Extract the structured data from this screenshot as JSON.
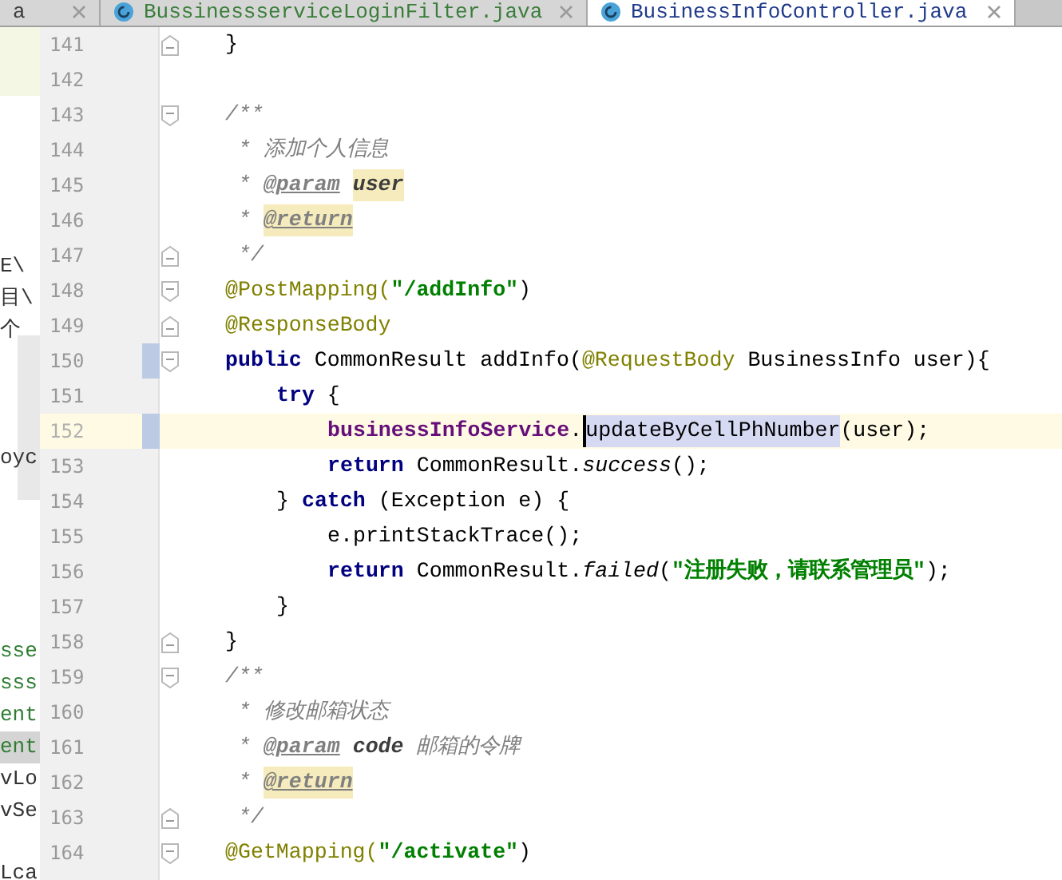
{
  "tabs": [
    {
      "label": "a",
      "selected": false,
      "color": "#3c3c3c",
      "partial": true
    },
    {
      "label": "BussinessserviceLoginFilter.java",
      "selected": false,
      "color": "#3a7d3a",
      "partial": false
    },
    {
      "label": "BusinessInfoController.java",
      "selected": true,
      "color": "#1f3a8a",
      "partial": false
    }
  ],
  "background_panel": {
    "groups": [
      [
        {
          "text": "E\\",
          "color": "#333333",
          "selected": false
        },
        {
          "text": "目\\",
          "color": "#333333",
          "selected": false
        },
        {
          "text": "个",
          "color": "#333333",
          "selected": false
        }
      ],
      [
        {
          "text": "oyc",
          "color": "#333333",
          "selected": false
        }
      ],
      [
        {
          "text": "sse",
          "color": "#2e7d32",
          "selected": false
        },
        {
          "text": "sss",
          "color": "#2e7d32",
          "selected": false
        },
        {
          "text": "ent",
          "color": "#2e7d32",
          "selected": false
        },
        {
          "text": "ent",
          "color": "#2e7d32",
          "selected": true
        },
        {
          "text": "vLo",
          "color": "#333333",
          "selected": false
        },
        {
          "text": "vSe",
          "color": "#333333",
          "selected": false
        }
      ],
      [
        {
          "text": "Lca",
          "color": "#333333",
          "selected": false
        }
      ]
    ]
  },
  "editor": {
    "lines": [
      {
        "number": "141",
        "current": false,
        "changed": false,
        "fold_start": false,
        "fold_end": true,
        "tokens": [
          {
            "kind": "plain",
            "text": "}"
          }
        ]
      },
      {
        "number": "142",
        "current": false,
        "changed": false,
        "fold_start": false,
        "fold_end": false
      },
      {
        "number": "143",
        "current": false,
        "changed": false,
        "fold_start": true,
        "fold_end": false,
        "tokens": [
          {
            "kind": "comment",
            "text": "/**"
          }
        ]
      },
      {
        "number": "144",
        "current": false,
        "changed": false,
        "fold_start": false,
        "fold_end": false,
        "tokens": [
          {
            "kind": "comment",
            "text": " * 添加个人信息"
          }
        ]
      },
      {
        "number": "145",
        "current": false,
        "changed": false,
        "fold_start": false,
        "fold_end": false,
        "tokens": [
          {
            "kind": "comment",
            "text": " * "
          },
          {
            "kind": "doctag",
            "text": "@param",
            "highlighted": false
          },
          {
            "kind": "docparam",
            "text": "user",
            "highlighted": true
          }
        ]
      },
      {
        "number": "146",
        "current": false,
        "changed": false,
        "fold_start": false,
        "fold_end": false,
        "tokens": [
          {
            "kind": "comment",
            "text": " * "
          },
          {
            "kind": "doctag",
            "text": "@return",
            "highlighted": true
          }
        ]
      },
      {
        "number": "147",
        "current": false,
        "changed": false,
        "fold_start": false,
        "fold_end": true,
        "tokens": [
          {
            "kind": "comment",
            "text": " */"
          }
        ]
      },
      {
        "number": "148",
        "current": false,
        "changed": false,
        "fold_start": true,
        "fold_end": false,
        "tokens": [
          {
            "kind": "annotation",
            "text": "@PostMapping("
          },
          {
            "kind": "string",
            "text": "\"/addInfo\""
          },
          {
            "kind": "plain",
            "text": ")"
          }
        ]
      },
      {
        "number": "149",
        "current": false,
        "changed": false,
        "fold_start": false,
        "fold_end": true,
        "tokens": [
          {
            "kind": "annotation",
            "text": "@ResponseBody"
          }
        ]
      },
      {
        "number": "150",
        "current": false,
        "changed": true,
        "fold_start": true,
        "fold_end": false,
        "tokens": [
          {
            "kind": "keyword",
            "text": "public"
          },
          {
            "kind": "plain",
            "text": " CommonResult addInfo("
          },
          {
            "kind": "annotation",
            "text": "@RequestBody"
          },
          {
            "kind": "plain",
            "text": " BusinessInfo user){"
          }
        ],
        "children": [
          {
            "number": "151",
            "current": false,
            "changed": false,
            "fold_start": false,
            "fold_end": false,
            "tokens": [
              {
                "kind": "keyword",
                "text": "try"
              },
              {
                "kind": "plain",
                "text": " {"
              }
            ],
            "children": [
              {
                "number": "152",
                "current": true,
                "changed": true,
                "fold_start": false,
                "fold_end": false,
                "tokens": [
                  {
                    "kind": "field",
                    "text": "businessInfoService"
                  },
                  {
                    "kind": "plain",
                    "text": "."
                  },
                  {
                    "kind": "selection",
                    "text": "updateByCellPhNumber",
                    "caret": true
                  },
                  {
                    "kind": "plain",
                    "text": "(user);"
                  }
                ]
              },
              {
                "number": "153",
                "current": false,
                "changed": false,
                "fold_start": false,
                "fold_end": false,
                "tokens": [
                  {
                    "kind": "keyword",
                    "text": "return"
                  },
                  {
                    "kind": "plain",
                    "text": " CommonResult."
                  },
                  {
                    "kind": "static",
                    "text": "success"
                  },
                  {
                    "kind": "plain",
                    "text": "();"
                  }
                ]
              }
            ]
          },
          {
            "number": "154",
            "current": false,
            "changed": false,
            "fold_start": false,
            "fold_end": false,
            "tokens": [
              {
                "kind": "plain",
                "text": "} "
              },
              {
                "kind": "keyword",
                "text": "catch"
              },
              {
                "kind": "plain",
                "text": " (Exception e) {"
              }
            ],
            "children": [
              {
                "number": "155",
                "current": false,
                "changed": false,
                "fold_start": false,
                "fold_end": false,
                "tokens": [
                  {
                    "kind": "plain",
                    "text": "e.printStackTrace();"
                  }
                ]
              },
              {
                "number": "156",
                "current": false,
                "changed": false,
                "fold_start": false,
                "fold_end": false,
                "tokens": [
                  {
                    "kind": "keyword",
                    "text": "return"
                  },
                  {
                    "kind": "plain",
                    "text": " CommonResult."
                  },
                  {
                    "kind": "static",
                    "text": "failed"
                  },
                  {
                    "kind": "plain",
                    "text": "("
                  },
                  {
                    "kind": "string",
                    "text": "\"注册失败，请联系管理员\""
                  },
                  {
                    "kind": "plain",
                    "text": ");"
                  }
                ]
              }
            ]
          },
          {
            "number": "157",
            "current": false,
            "changed": false,
            "fold_start": false,
            "fold_end": false,
            "tokens": [
              {
                "kind": "plain",
                "text": "}"
              }
            ]
          }
        ]
      },
      {
        "number": "158",
        "current": false,
        "changed": false,
        "fold_start": false,
        "fold_end": true,
        "tokens": [
          {
            "kind": "plain",
            "text": "}"
          }
        ]
      },
      {
        "number": "159",
        "current": false,
        "changed": false,
        "fold_start": true,
        "fold_end": false,
        "tokens": [
          {
            "kind": "comment",
            "text": "/**"
          }
        ]
      },
      {
        "number": "160",
        "current": false,
        "changed": false,
        "fold_start": false,
        "fold_end": false,
        "tokens": [
          {
            "kind": "comment",
            "text": " * 修改邮箱状态"
          }
        ]
      },
      {
        "number": "161",
        "current": false,
        "changed": false,
        "fold_start": false,
        "fold_end": false,
        "tokens": [
          {
            "kind": "comment",
            "text": " * "
          },
          {
            "kind": "doctag",
            "text": "@param",
            "highlighted": false
          },
          {
            "kind": "docparam",
            "text": "code",
            "highlighted": false
          },
          {
            "kind": "comment",
            "text": " 邮箱的令牌"
          }
        ]
      },
      {
        "number": "162",
        "current": false,
        "changed": false,
        "fold_start": false,
        "fold_end": false,
        "tokens": [
          {
            "kind": "comment",
            "text": " * "
          },
          {
            "kind": "doctag",
            "text": "@return",
            "highlighted": true
          }
        ]
      },
      {
        "number": "163",
        "current": false,
        "changed": false,
        "fold_start": false,
        "fold_end": true,
        "tokens": [
          {
            "kind": "comment",
            "text": " */"
          }
        ]
      },
      {
        "number": "164",
        "current": false,
        "changed": false,
        "fold_start": true,
        "fold_end": false,
        "tokens": [
          {
            "kind": "annotation",
            "text": "@GetMapping("
          },
          {
            "kind": "string",
            "text": "\"/activate\""
          },
          {
            "kind": "plain",
            "text": ")"
          }
        ]
      }
    ]
  }
}
